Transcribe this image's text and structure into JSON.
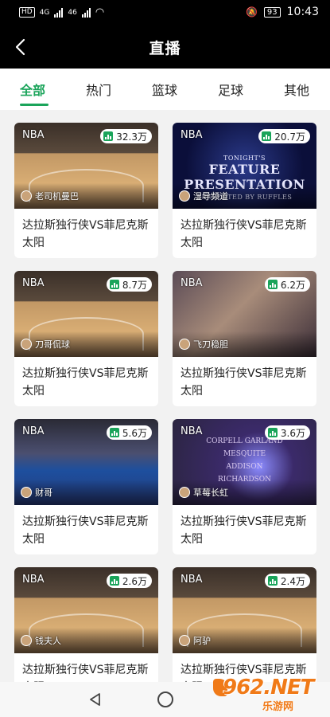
{
  "status_bar": {
    "left_badges": [
      "HD",
      "4G",
      "46",
      "HD",
      "4G"
    ],
    "battery": "93",
    "time": "10:43"
  },
  "header": {
    "title": "直播"
  },
  "tabs": [
    {
      "label": "全部",
      "active": true
    },
    {
      "label": "热门"
    },
    {
      "label": "篮球"
    },
    {
      "label": "足球"
    },
    {
      "label": "其他"
    }
  ],
  "cards": [
    {
      "league": "NBA",
      "viewers": "32.3万",
      "anchor": "老司机曼巴",
      "title": "达拉斯独行侠VS菲尼克斯太阳",
      "thumb": "court"
    },
    {
      "league": "NBA",
      "viewers": "20.7万",
      "anchor": "湿导频道",
      "title": "达拉斯独行侠VS菲尼克斯太阳",
      "thumb": "feature"
    },
    {
      "league": "NBA",
      "viewers": "8.7万",
      "anchor": "刀哥侃球",
      "title": "达拉斯独行侠VS菲尼克斯太阳",
      "thumb": "court"
    },
    {
      "league": "NBA",
      "viewers": "6.2万",
      "anchor": "飞刀稳胆",
      "title": "达拉斯独行侠VS菲尼克斯太阳",
      "thumb": "closeup"
    },
    {
      "league": "NBA",
      "viewers": "5.6万",
      "anchor": "财哥",
      "title": "达拉斯独行侠VS菲尼克斯太阳",
      "thumb": "crowd"
    },
    {
      "league": "NBA",
      "viewers": "3.6万",
      "anchor": "草莓长虹",
      "title": "达拉斯独行侠VS菲尼克斯太阳",
      "thumb": "purple"
    },
    {
      "league": "NBA",
      "viewers": "2.6万",
      "anchor": "钱夫人",
      "title": "达拉斯独行侠VS菲尼克斯太阳",
      "thumb": "court"
    },
    {
      "league": "NBA",
      "viewers": "2.4万",
      "anchor": "阿驴",
      "title": "达拉斯独行侠VS菲尼克斯太阳",
      "thumb": "court"
    }
  ],
  "thumb_text": {
    "feature_line1": "TONIGHT'S",
    "feature_line2": "FEATURE PRESENTATION",
    "feature_line3": "PRESENTED BY RUFFLES",
    "purple_names": [
      "CORPELL  GARLAND",
      "MESQUITE",
      "ADDISON",
      "RICHARDSON"
    ]
  },
  "watermark": {
    "big": "962.NET",
    "sub": "乐游网"
  },
  "colors": {
    "accent": "#1aa45a",
    "header_bg": "#000000",
    "watermark": "#f07a18"
  }
}
